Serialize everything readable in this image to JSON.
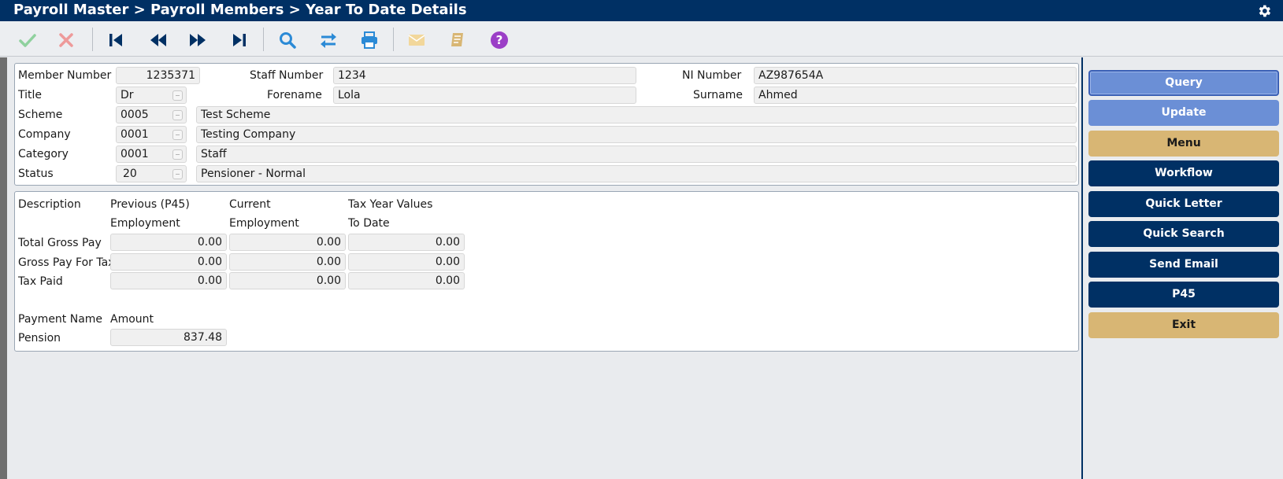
{
  "window": {
    "title": "Payroll Master > Payroll Members > Year To Date Details"
  },
  "icons": {
    "settings": "gear-icon",
    "toolbar": [
      "check-icon",
      "close-icon",
      "first-record-icon",
      "previous-record-icon",
      "next-record-icon",
      "last-record-icon",
      "search-icon",
      "swap-icon",
      "print-icon",
      "email-icon",
      "notes-icon",
      "help-icon"
    ]
  },
  "colors": {
    "header": "#003064",
    "query_button": "#6b8fd6",
    "menu_button": "#d8b674",
    "nav_button": "#003064"
  },
  "member": {
    "member_number_label": "Member Number",
    "member_number": "1235371",
    "staff_number_label": "Staff Number",
    "staff_number": "1234",
    "ni_number_label": "NI Number",
    "ni_number": "AZ987654A",
    "title_label": "Title",
    "title": "Dr",
    "forename_label": "Forename",
    "forename": "Lola",
    "surname_label": "Surname",
    "surname": "Ahmed",
    "scheme_label": "Scheme",
    "scheme_code": "0005",
    "scheme_name": "Test Scheme",
    "company_label": "Company",
    "company_code": "0001",
    "company_name": "Testing Company",
    "category_label": "Category",
    "category_code": "0001",
    "category_name": "Staff",
    "status_label": "Status",
    "status_code": "20",
    "status_name": "Pensioner - Normal"
  },
  "ytd": {
    "headers": {
      "description": "Description",
      "previous_1": "Previous (P45)",
      "previous_2": "Employment",
      "current_1": "Current",
      "current_2": "Employment",
      "taxyear_1": "Tax Year Values",
      "taxyear_2": "To Date"
    },
    "rows": [
      {
        "label": "Total Gross Pay",
        "previous": "0.00",
        "current": "0.00",
        "to_date": "0.00"
      },
      {
        "label": "Gross Pay For Tax",
        "previous": "0.00",
        "current": "0.00",
        "to_date": "0.00"
      },
      {
        "label": "Tax Paid",
        "previous": "0.00",
        "current": "0.00",
        "to_date": "0.00"
      }
    ],
    "payments_header": {
      "name": "Payment Name",
      "amount": "Amount"
    },
    "payments": [
      {
        "name": "Pension",
        "amount": "837.48"
      }
    ]
  },
  "sidebar": {
    "buttons": [
      "Query",
      "Update",
      "Menu",
      "Workflow",
      "Quick Letter",
      "Quick Search",
      "Send Email",
      "P45",
      "Exit"
    ]
  }
}
